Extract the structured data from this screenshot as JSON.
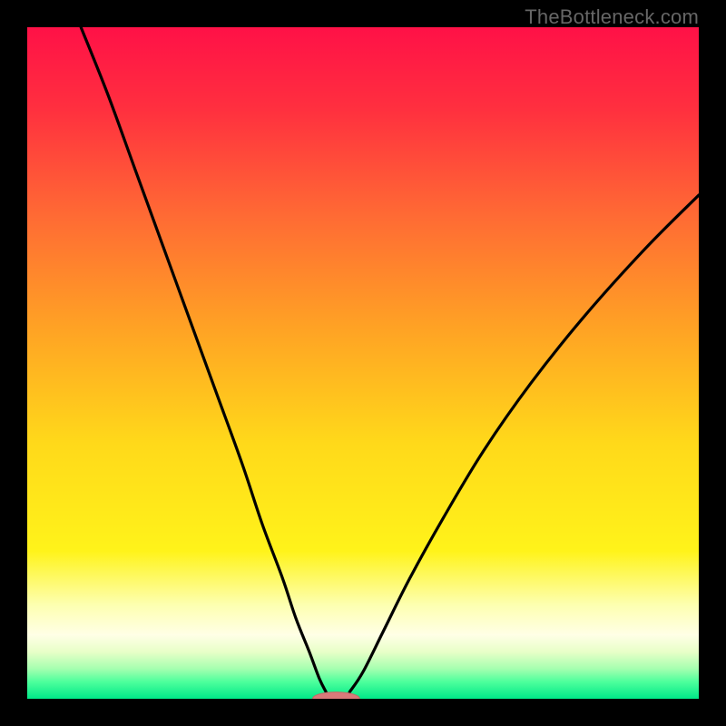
{
  "watermark": "TheBottleneck.com",
  "colors": {
    "frame": "#000000",
    "curve": "#000000",
    "marker_fill": "#d97a7a",
    "gradient_stops": [
      {
        "offset": 0.0,
        "color": "#ff1147"
      },
      {
        "offset": 0.12,
        "color": "#ff2f3f"
      },
      {
        "offset": 0.28,
        "color": "#ff6a34"
      },
      {
        "offset": 0.45,
        "color": "#ffa324"
      },
      {
        "offset": 0.62,
        "color": "#ffd91a"
      },
      {
        "offset": 0.78,
        "color": "#fff31a"
      },
      {
        "offset": 0.86,
        "color": "#fdffb0"
      },
      {
        "offset": 0.905,
        "color": "#ffffe6"
      },
      {
        "offset": 0.93,
        "color": "#e8ffc8"
      },
      {
        "offset": 0.955,
        "color": "#a6ffb0"
      },
      {
        "offset": 0.975,
        "color": "#4cff9c"
      },
      {
        "offset": 1.0,
        "color": "#00e888"
      }
    ]
  },
  "chart_data": {
    "type": "line",
    "title": "",
    "xlabel": "",
    "ylabel": "",
    "xlim": [
      0,
      100
    ],
    "ylim": [
      0,
      100
    ],
    "grid": false,
    "legend": false,
    "series": [
      {
        "name": "left-branch",
        "x": [
          8,
          12,
          16,
          20,
          24,
          28,
          32,
          35,
          38,
          40,
          42,
          43.5,
          44.5
        ],
        "values": [
          100,
          90,
          79,
          68,
          57,
          46,
          35,
          26,
          18,
          12,
          7,
          3,
          1
        ]
      },
      {
        "name": "right-branch",
        "x": [
          48,
          50,
          53,
          57,
          62,
          68,
          75,
          83,
          92,
          100
        ],
        "values": [
          1,
          4,
          10,
          18,
          27,
          37,
          47,
          57,
          67,
          75
        ]
      }
    ],
    "marker": {
      "x_center": 46,
      "y": 0,
      "rx": 3.5,
      "ry": 1.0
    }
  }
}
